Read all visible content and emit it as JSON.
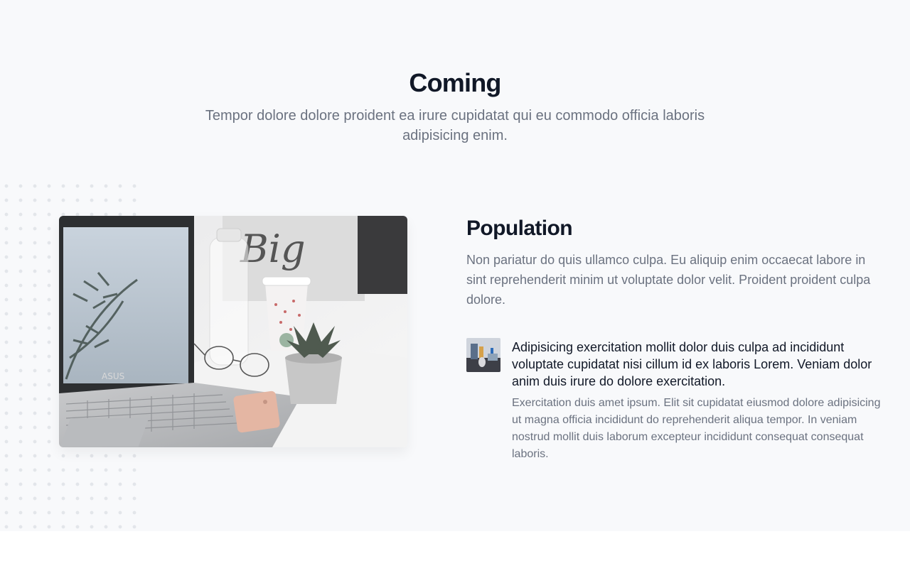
{
  "header": {
    "title": "Coming",
    "subtitle": "Tempor dolore dolore proident ea irure cupidatat qui eu commodo officia laboris adipisicing enim."
  },
  "hero_image": {
    "description_icon": "laptop-photo"
  },
  "feature": {
    "title": "Population",
    "description": "Non pariatur do quis ullamco culpa. Eu aliquip enim occaecat labore in sint reprehenderit minim ut voluptate dolor velit. Proident proident culpa dolore."
  },
  "item": {
    "title": "Adipisicing exercitation mollit dolor duis culpa ad incididunt voluptate cupidatat nisi cillum id ex laboris Lorem. Veniam dolor anim duis irure do dolore exercitation.",
    "text": "Exercitation duis amet ipsum. Elit sit cupidatat eiusmod dolore adipisicing ut magna officia incididunt do reprehenderit aliqua tempor. In veniam nostrud mollit duis laborum excepteur incididunt consequat consequat laboris."
  },
  "colors": {
    "section_bg": "#f8f9fb",
    "heading": "#111827",
    "muted_text": "#6b7280",
    "dot_pattern": "#e3e6ea"
  }
}
